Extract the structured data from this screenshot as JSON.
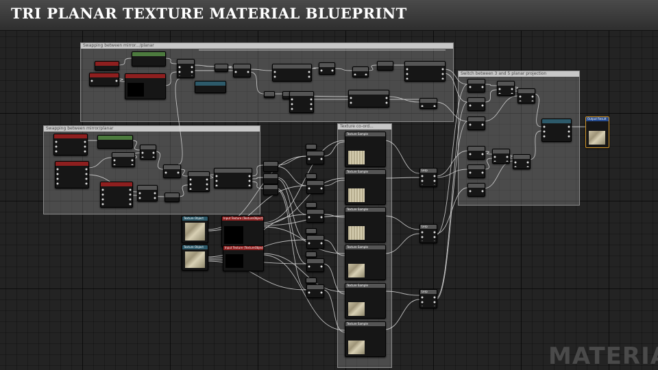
{
  "header": {
    "title": "TRI PLANAR TEXTURE MATERIAL BLUEPRINT"
  },
  "comments": {
    "top": "Swapping between mirror.../planar",
    "left": "Swapping between mirror/planar",
    "center": "Texture co-ord...",
    "right": "Switch between 3 and 5 planar projection"
  },
  "nodes": {
    "texture_object_1": "Texture Object",
    "texture_object_2": "Texture Object",
    "texture_param_1": "Input Texture (TextureObject)",
    "texture_param_2": "Input Texture (TextureObject)",
    "texture_sample": "Texture Sample",
    "lerp": "Lerp",
    "output": "Output Result"
  },
  "watermark": "MATERIAL"
}
